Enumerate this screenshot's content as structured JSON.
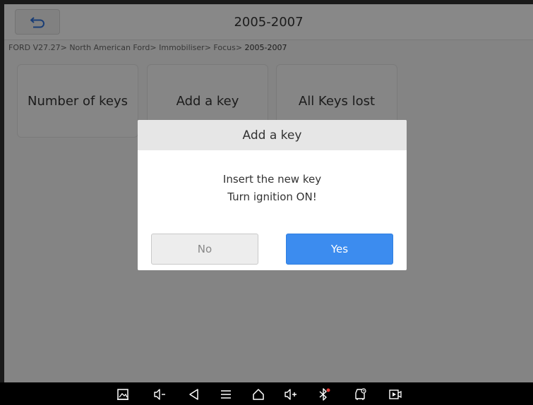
{
  "header": {
    "title": "2005-2007",
    "back_icon": "back-arrow-icon"
  },
  "breadcrumb": {
    "path": "FORD V27.27> North American Ford> Immobiliser> Focus> ",
    "current": "2005-2007"
  },
  "tiles": [
    {
      "label": "Number of keys"
    },
    {
      "label": "Add a key"
    },
    {
      "label": "All Keys lost"
    }
  ],
  "dialog": {
    "title": "Add a key",
    "line1": "Insert the new key",
    "line2": "Turn ignition ON!",
    "no_label": "No",
    "yes_label": "Yes"
  },
  "navbar": {
    "icons": [
      "screenshot-icon",
      "volume-down-icon",
      "back-icon",
      "menu-icon",
      "home-icon",
      "volume-up-icon",
      "bluetooth-icon",
      "vci-icon",
      "screen-record-icon"
    ]
  },
  "colors": {
    "accent": "#3c8cef",
    "overlay": "rgba(0,0,0,0.45)"
  }
}
